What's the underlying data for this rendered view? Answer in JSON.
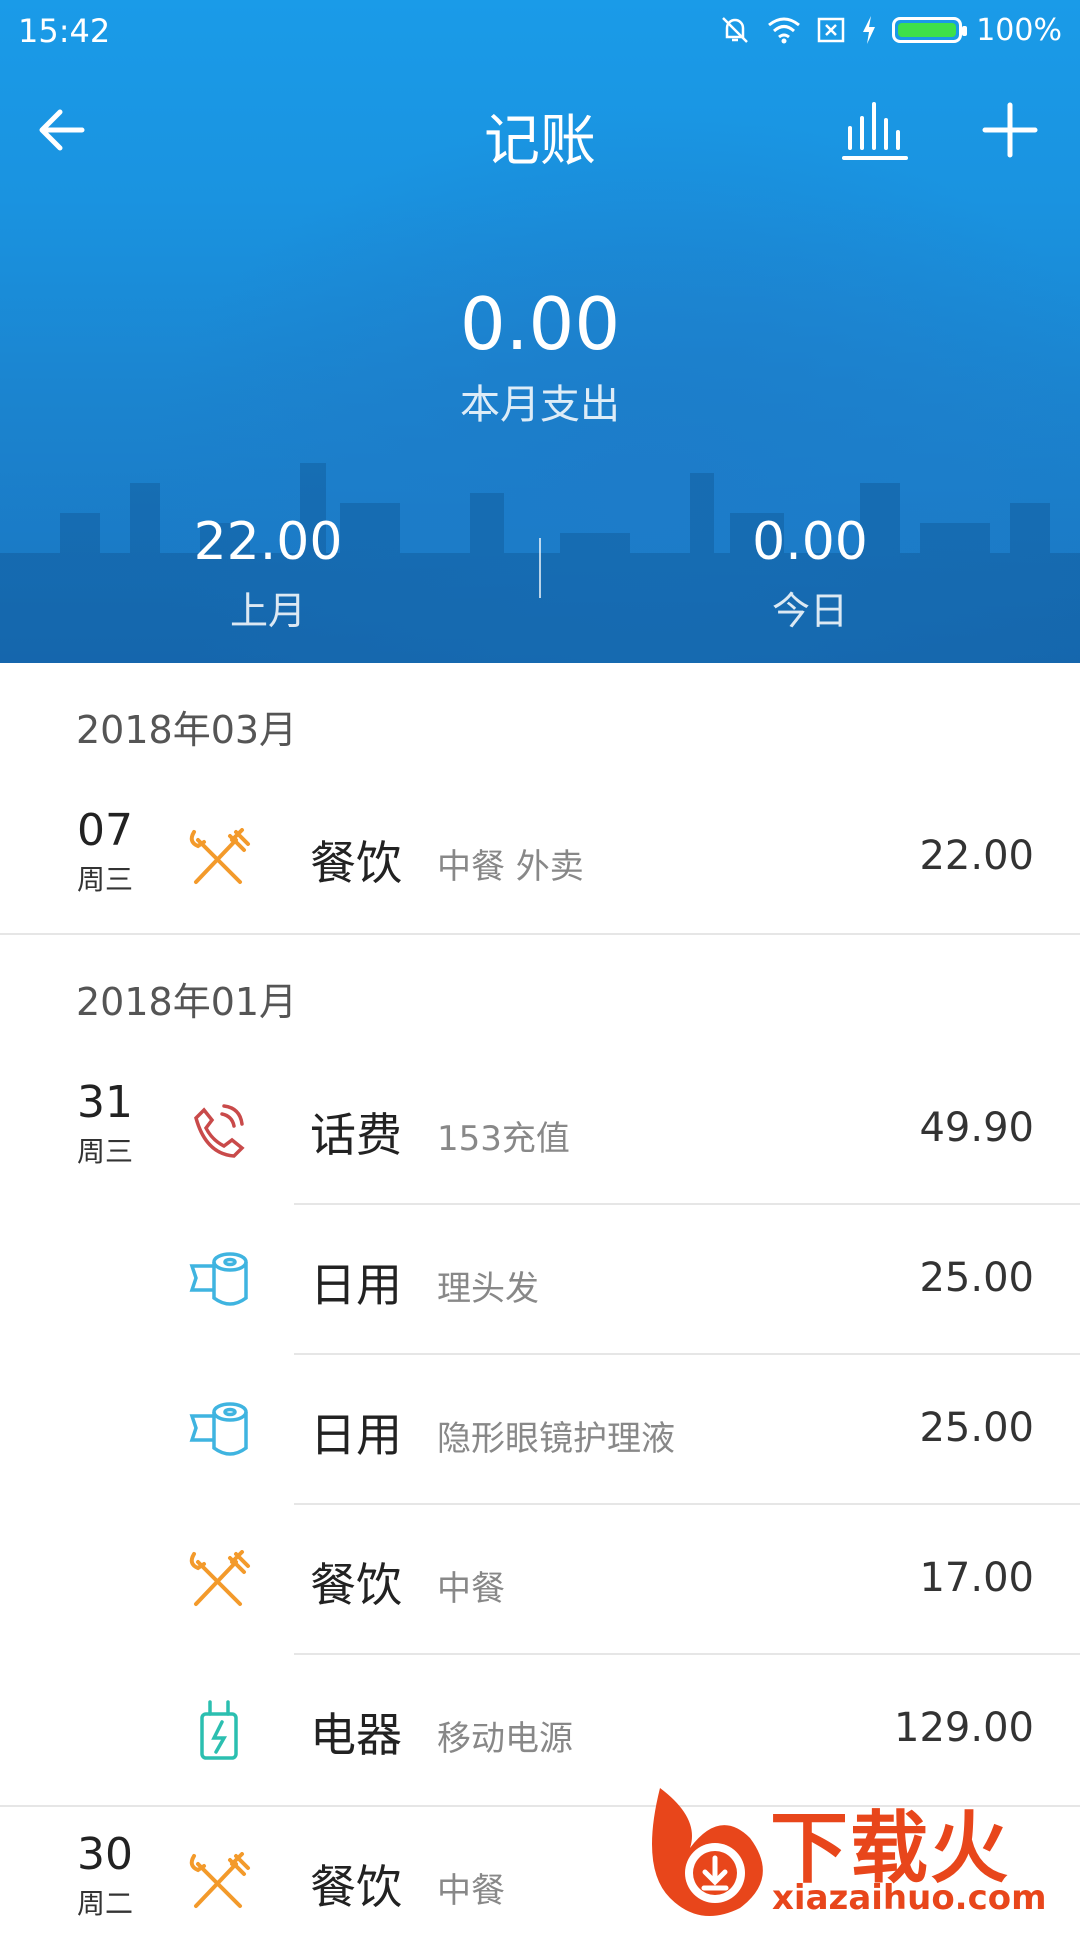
{
  "status": {
    "time": "15:42",
    "battery": "100%"
  },
  "appbar": {
    "title": "记账"
  },
  "summary": {
    "this_month_amount": "0.00",
    "this_month_label": "本月支出",
    "last_month_amount": "22.00",
    "last_month_label": "上月",
    "today_amount": "0.00",
    "today_label": "今日"
  },
  "groups": [
    {
      "month": "2018年03月",
      "days": [
        {
          "day": "07",
          "weekday": "周三",
          "entries": [
            {
              "icon": "utensils-icon",
              "category": "餐饮",
              "note": "中餐 外卖",
              "amount": "22.00"
            }
          ]
        }
      ]
    },
    {
      "month": "2018年01月",
      "days": [
        {
          "day": "31",
          "weekday": "周三",
          "entries": [
            {
              "icon": "phone-icon",
              "category": "话费",
              "note": "153充值",
              "amount": "49.90"
            },
            {
              "icon": "tissue-roll-icon",
              "category": "日用",
              "note": "理头发",
              "amount": "25.00"
            },
            {
              "icon": "tissue-roll-icon",
              "category": "日用",
              "note": "隐形眼镜护理液",
              "amount": "25.00"
            },
            {
              "icon": "utensils-icon",
              "category": "餐饮",
              "note": "中餐",
              "amount": "17.00"
            },
            {
              "icon": "charger-icon",
              "category": "电器",
              "note": "移动电源",
              "amount": "129.00"
            }
          ]
        },
        {
          "day": "30",
          "weekday": "周二",
          "entries": [
            {
              "icon": "utensils-icon",
              "category": "餐饮",
              "note": "中餐",
              "amount": ""
            }
          ]
        }
      ]
    }
  ],
  "colors": {
    "header_blue": "#1a93e0",
    "food_orange": "#f39a2b",
    "phone_red": "#c94a4a",
    "daily_blue": "#3fb4e0",
    "device_teal": "#2bbfb0",
    "watermark": "#e8461b"
  },
  "watermark": {
    "text": "下载火",
    "url": "xiazaihuo.com"
  }
}
